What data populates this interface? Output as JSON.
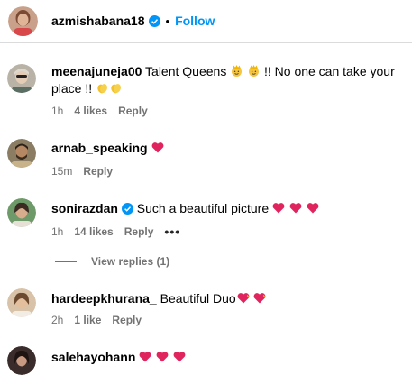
{
  "post_header": {
    "username": "azmishabana18",
    "separator": "•",
    "follow_label": "Follow"
  },
  "comments": [
    {
      "username": "meenajuneja00",
      "text_a": "Talent Queens ",
      "text_b": " !! No one can take your place !! ",
      "time": "1h",
      "likes": "4 likes",
      "reply_label": "Reply"
    },
    {
      "username": "arnab_speaking",
      "time": "15m",
      "reply_label": "Reply"
    },
    {
      "username": "sonirazdan",
      "text": "Such a beautiful picture",
      "time": "1h",
      "likes": "14 likes",
      "reply_label": "Reply",
      "more_label": "•••"
    },
    {
      "username": "hardeepkhurana_",
      "text": "Beautiful Duo",
      "time": "2h",
      "likes": "1 like",
      "reply_label": "Reply"
    },
    {
      "username": "salehayohann"
    }
  ],
  "view_replies_label": "View replies (1)",
  "colors": {
    "follow_blue": "#0095f6",
    "verified_blue": "#0095f6",
    "heart_red": "#e0245e",
    "meta_gray": "#737373"
  },
  "icons": [
    "verified-badge-icon",
    "red-heart-icon",
    "heart-on-fire-icon",
    "princess-emoji-icon",
    "clapping-hands-icon"
  ]
}
